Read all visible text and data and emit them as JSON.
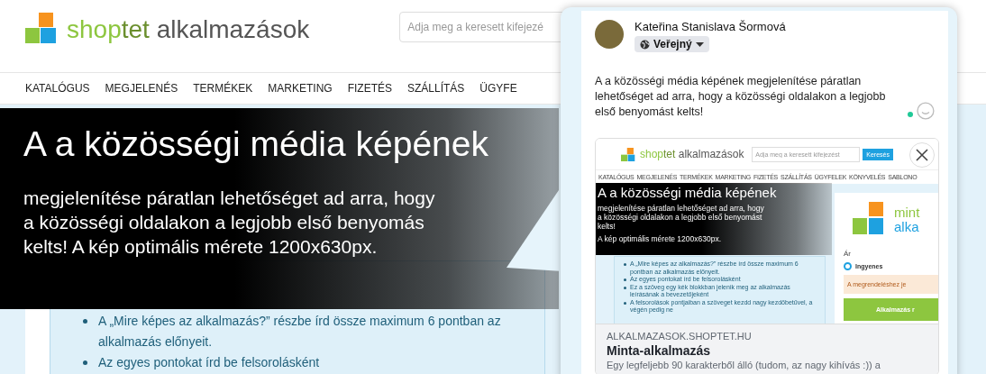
{
  "header": {
    "logo": {
      "brand_first": "shop",
      "brand_second": "tet",
      "product": "alkalmazások"
    },
    "search": {
      "placeholder": "Adja meg a keresett kifejezé"
    }
  },
  "nav": [
    "KATALÓGUS",
    "MEGJELENÉS",
    "TERMÉKEK",
    "MARKETING",
    "FIZETÉS",
    "SZÁLLÍTÁS",
    "ÜGYFE"
  ],
  "banner": {
    "title": "A a közösségi média képének",
    "lines": [
      "megjelenítése páratlan lehetőséget ad arra, hogy",
      "a közösségi oldalakon a legjobb első benyomás",
      "kelts! A kép optimális mérete 1200x630px."
    ]
  },
  "content": {
    "bullets": [
      "A „Mire képes az alkalmazás?” részbe írd össze maximum 6 pontban az alkalmazás előnyeit.",
      "Az egyes pontokat írd be felsorolásként"
    ]
  },
  "post": {
    "author": "Kateřina Stanislava Šormová",
    "audience": "Veřejný",
    "text": "A a közösségi média képének megjelenítése páratlan lehetőséget ad arra, hogy a közösségi oldalakon a legjobb első benyomást kelts!",
    "link_preview": {
      "screenshot": {
        "logo": {
          "brand_first": "shop",
          "brand_second": "tet",
          "product": "alkalmazások"
        },
        "search": {
          "placeholder": "Adja meg a keresett kifejezést"
        },
        "search_button": "Keresés",
        "nav": [
          "KATALÓGUS",
          "MEGJELENÉS",
          "TERMÉKEK",
          "MARKETING",
          "FIZETÉS",
          "SZÁLLÍTÁS",
          "ÜGYFELEK",
          "KÖNYVELÉS",
          "SABLONO"
        ],
        "banner": {
          "title": "A a közösségi média képének",
          "lines": [
            "megjelenítése páratlan lehetőséget ad arra, hogy",
            "a közösségi oldalakon a legjobb első benyomást",
            "kelts!"
          ],
          "note": "A kép optimális mérete 1200x630px."
        },
        "bullets": [
          "A „Mire képes az alkalmazás?” részbe írd össze maximum 6 pontban az alkalmazás előnyeit.",
          "Az egyes pontokat írd be felsorolásként",
          "Ez a szöveg egy kék blokkban jelenik meg az alkalmazás leírásának a bevezetőjeként",
          "A felsorolások pontjaiban a szöveget kezdd nagy kezdőbetűvel, a végén pedig ne"
        ],
        "sidebar": {
          "logo_lines": [
            "mint",
            "alka"
          ],
          "price_label": "Ár",
          "options": [
            {
              "label": "Ingyenes",
              "selected": true
            }
          ],
          "notice": "A megrendeléshez je",
          "order_button": "Alkalmazás r"
        }
      },
      "domain": "ALKALMAZASOK.SHOPTET.HU",
      "title": "Minta-alkalmazás",
      "description": "Egy legfeljebb 90 karakterből álló (tudom, az nagy kihívás :)) a"
    }
  }
}
